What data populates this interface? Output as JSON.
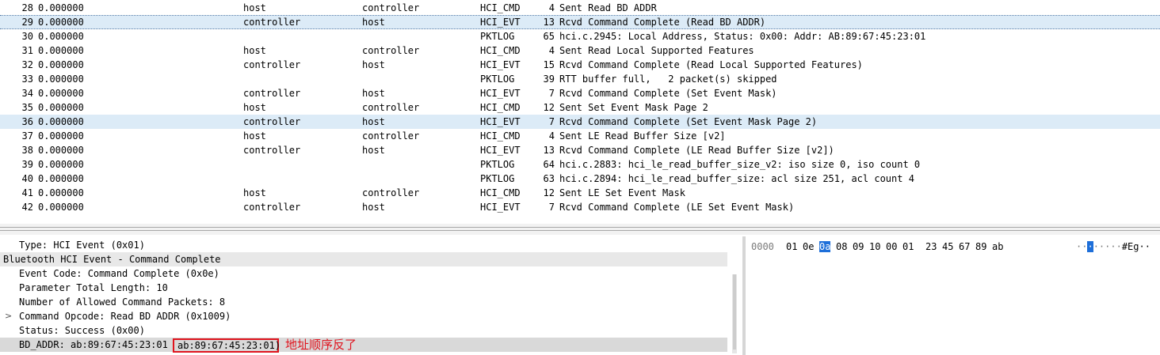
{
  "packets": [
    {
      "no": "28",
      "time": "0.000000",
      "source": "host",
      "destination": "controller",
      "protocol": "HCI_CMD",
      "length": "4",
      "info": "Sent Read BD ADDR"
    },
    {
      "no": "29",
      "time": "0.000000",
      "source": "controller",
      "destination": "host",
      "protocol": "HCI_EVT",
      "length": "13",
      "info": "Rcvd Command Complete (Read BD ADDR)"
    },
    {
      "no": "30",
      "time": "0.000000",
      "source": "",
      "destination": "",
      "protocol": "PKTLOG",
      "length": "65",
      "info": "hci.c.2945: Local Address, Status: 0x00: Addr: AB:89:67:45:23:01"
    },
    {
      "no": "31",
      "time": "0.000000",
      "source": "host",
      "destination": "controller",
      "protocol": "HCI_CMD",
      "length": "4",
      "info": "Sent Read Local Supported Features"
    },
    {
      "no": "32",
      "time": "0.000000",
      "source": "controller",
      "destination": "host",
      "protocol": "HCI_EVT",
      "length": "15",
      "info": "Rcvd Command Complete (Read Local Supported Features)"
    },
    {
      "no": "33",
      "time": "0.000000",
      "source": "",
      "destination": "",
      "protocol": "PKTLOG",
      "length": "39",
      "info": "RTT buffer full,   2 packet(s) skipped"
    },
    {
      "no": "34",
      "time": "0.000000",
      "source": "controller",
      "destination": "host",
      "protocol": "HCI_EVT",
      "length": "7",
      "info": "Rcvd Command Complete (Set Event Mask)"
    },
    {
      "no": "35",
      "time": "0.000000",
      "source": "host",
      "destination": "controller",
      "protocol": "HCI_CMD",
      "length": "12",
      "info": "Sent Set Event Mask Page 2"
    },
    {
      "no": "36",
      "time": "0.000000",
      "source": "controller",
      "destination": "host",
      "protocol": "HCI_EVT",
      "length": "7",
      "info": "Rcvd Command Complete (Set Event Mask Page 2)"
    },
    {
      "no": "37",
      "time": "0.000000",
      "source": "host",
      "destination": "controller",
      "protocol": "HCI_CMD",
      "length": "4",
      "info": "Sent LE Read Buffer Size [v2]"
    },
    {
      "no": "38",
      "time": "0.000000",
      "source": "controller",
      "destination": "host",
      "protocol": "HCI_EVT",
      "length": "13",
      "info": "Rcvd Command Complete (LE Read Buffer Size [v2])"
    },
    {
      "no": "39",
      "time": "0.000000",
      "source": "",
      "destination": "",
      "protocol": "PKTLOG",
      "length": "64",
      "info": "hci.c.2883: hci_le_read_buffer_size_v2: iso size 0, iso count 0"
    },
    {
      "no": "40",
      "time": "0.000000",
      "source": "",
      "destination": "",
      "protocol": "PKTLOG",
      "length": "63",
      "info": "hci.c.2894: hci_le_read_buffer_size: acl size 251, acl count 4"
    },
    {
      "no": "41",
      "time": "0.000000",
      "source": "host",
      "destination": "controller",
      "protocol": "HCI_CMD",
      "length": "12",
      "info": "Sent LE Set Event Mask"
    },
    {
      "no": "42",
      "time": "0.000000",
      "source": "controller",
      "destination": "host",
      "protocol": "HCI_EVT",
      "length": "7",
      "info": "Rcvd Command Complete (LE Set Event Mask)"
    }
  ],
  "details": {
    "type_line": "Type: HCI Event (0x01)",
    "section_header": "Bluetooth HCI Event - Command Complete",
    "event_code": "Event Code: Command Complete (0x0e)",
    "param_length": "Parameter Total Length: 10",
    "allowed_packets": "Number of Allowed Command Packets: 8",
    "opcode": "Command Opcode: Read BD ADDR (0x1009)",
    "status": "Status: Success (0x00)",
    "bd_addr": "BD_ADDR: ab:89:67:45:23:01",
    "expander_glyph": ">"
  },
  "annotation": {
    "boxed_value": "ab:89:67:45:23:01)",
    "note": "地址顺序反了",
    "color": "#e0141e"
  },
  "bytes": {
    "offset": "0000",
    "hex": [
      "01",
      "0e",
      "0a",
      "08",
      "09",
      "10",
      "00",
      "01",
      "23",
      "45",
      "67",
      "89",
      "ab"
    ],
    "selected_index": 2,
    "ascii_prefix": "··",
    "ascii_selected": "·",
    "ascii_rest": "·····",
    "ascii_tail": "#Eg··"
  },
  "colors": {
    "selection_bg": "#dcebf7",
    "byte_highlight": "#1e6fd9"
  }
}
